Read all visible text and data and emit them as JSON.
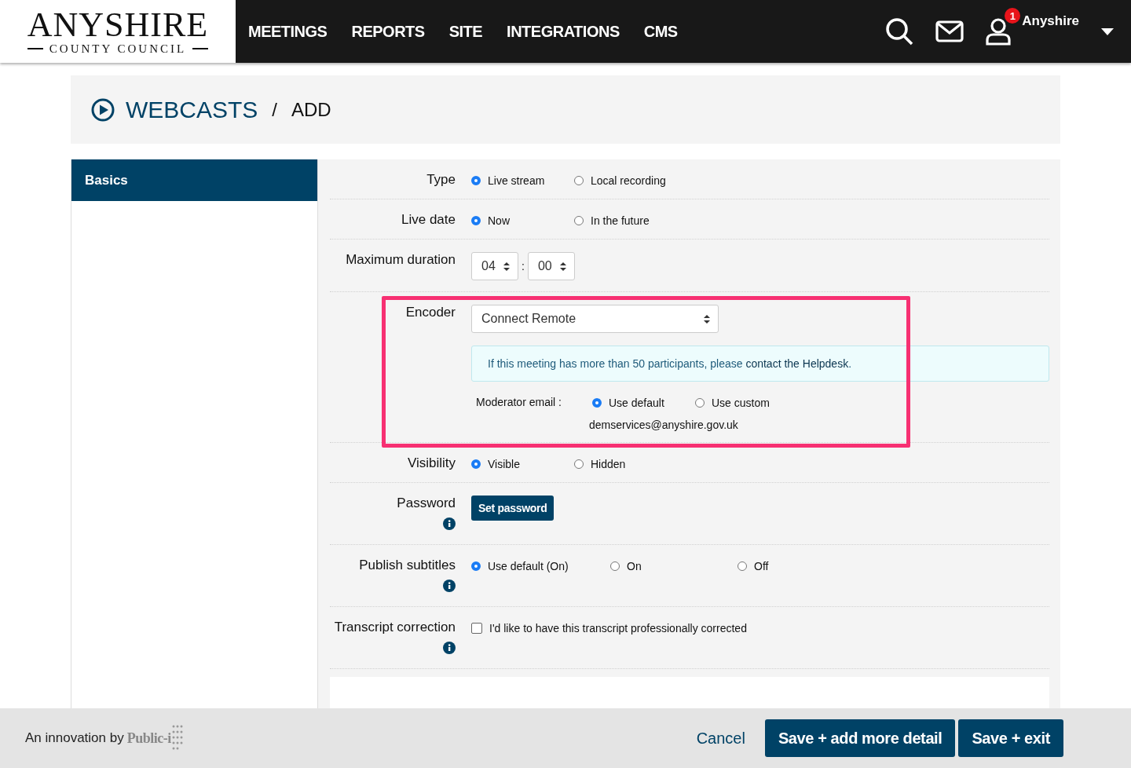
{
  "logo": {
    "name": "ANYSHIRE",
    "subtitle": "COUNTY COUNCIL"
  },
  "nav": [
    {
      "label": "MEETINGS"
    },
    {
      "label": "REPORTS"
    },
    {
      "label": "SITE"
    },
    {
      "label": "INTEGRATIONS"
    },
    {
      "label": "CMS"
    }
  ],
  "user": {
    "name": "Anyshire",
    "badge": "1"
  },
  "breadcrumb": {
    "section": "WEBCASTS",
    "separator": "/",
    "page": "ADD"
  },
  "sidebar": {
    "items": [
      {
        "label": "Basics",
        "selected": true
      }
    ]
  },
  "form": {
    "rows": [
      {
        "kind": "radio",
        "label": "Type",
        "info": false,
        "highlighted": false,
        "options": [
          {
            "label": "Live stream",
            "selected": true
          },
          {
            "label": "Local recording",
            "selected": false
          }
        ]
      },
      {
        "kind": "radio",
        "label": "Live date",
        "info": false,
        "highlighted": false,
        "options": [
          {
            "label": "Now",
            "selected": true
          },
          {
            "label": "In the future",
            "selected": false
          }
        ]
      },
      {
        "kind": "duration",
        "label": "Maximum duration",
        "info": false,
        "highlighted": false,
        "hours": "04",
        "separator": ":",
        "minutes": "00"
      },
      {
        "kind": "encoder",
        "label": "Encoder",
        "info": false,
        "highlighted": true,
        "value": "Connect Remote",
        "notice": "If this meeting has more than 50 participants, please",
        "notice_link": "contact the Helpdesk",
        "notice_end": ".",
        "moderator_label": "Moderator email :",
        "moderator_options": [
          {
            "label": "Use default",
            "selected": true
          },
          {
            "label": "Use custom",
            "selected": false
          }
        ],
        "email": "demservices@anyshire.gov.uk"
      },
      {
        "kind": "radio",
        "label": "Visibility",
        "info": false,
        "highlighted": false,
        "options": [
          {
            "label": "Visible",
            "selected": true
          },
          {
            "label": "Hidden",
            "selected": false
          }
        ]
      },
      {
        "kind": "button",
        "label": "Password",
        "info": true,
        "highlighted": false,
        "button": "Set password"
      },
      {
        "kind": "radio",
        "label": "Publish subtitles",
        "info": true,
        "highlighted": false,
        "options": [
          {
            "label": "Use default (On)",
            "selected": true
          },
          {
            "label": "On",
            "selected": false
          },
          {
            "label": "Off",
            "selected": false
          }
        ]
      },
      {
        "kind": "checkbox",
        "label": "Transcript correction",
        "info": true,
        "highlighted": false,
        "checked": false,
        "text": "I'd like to have this transcript professionally corrected"
      }
    ]
  },
  "footer": {
    "credit": "An innovation by",
    "brand": "Public-i",
    "cancel": "Cancel",
    "buttons": [
      "Save + add more detail",
      "Save + exit"
    ]
  }
}
